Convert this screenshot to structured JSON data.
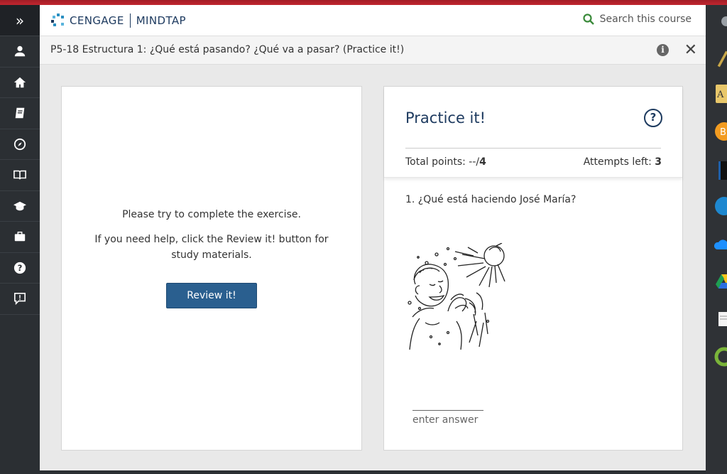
{
  "header": {
    "brand": "CENGAGE",
    "product": "MINDTAP",
    "search_label": "Search this course"
  },
  "nav": {
    "items": [
      "expand",
      "profile",
      "home",
      "notebook",
      "compass",
      "book",
      "graduation-cap",
      "briefcase",
      "help",
      "feedback"
    ]
  },
  "titlebar": {
    "title": "P5-18 Estructura 1: ¿Qué está pasando? ¿Qué va a pasar? (Practice it!)",
    "info": "i",
    "close": "✕"
  },
  "left_panel": {
    "message": "Please try to complete the exercise.",
    "help_text": "If you need help, click the Review it! button for study materials.",
    "review_button": "Review it!"
  },
  "right_panel": {
    "heading": "Practice it!",
    "help_icon": "?",
    "total_points_label": "Total points: --/",
    "total_points_value": "4",
    "attempts_label": "Attempts left: ",
    "attempts_value": "3",
    "question": "1. ¿Qué está haciendo José María?",
    "answer_placeholder": "enter answer"
  },
  "colors": {
    "accent": "#2a5f8f",
    "heading": "#1d3a5f",
    "nav_bg": "#2b2f33",
    "top_strip": "#b0202a"
  }
}
